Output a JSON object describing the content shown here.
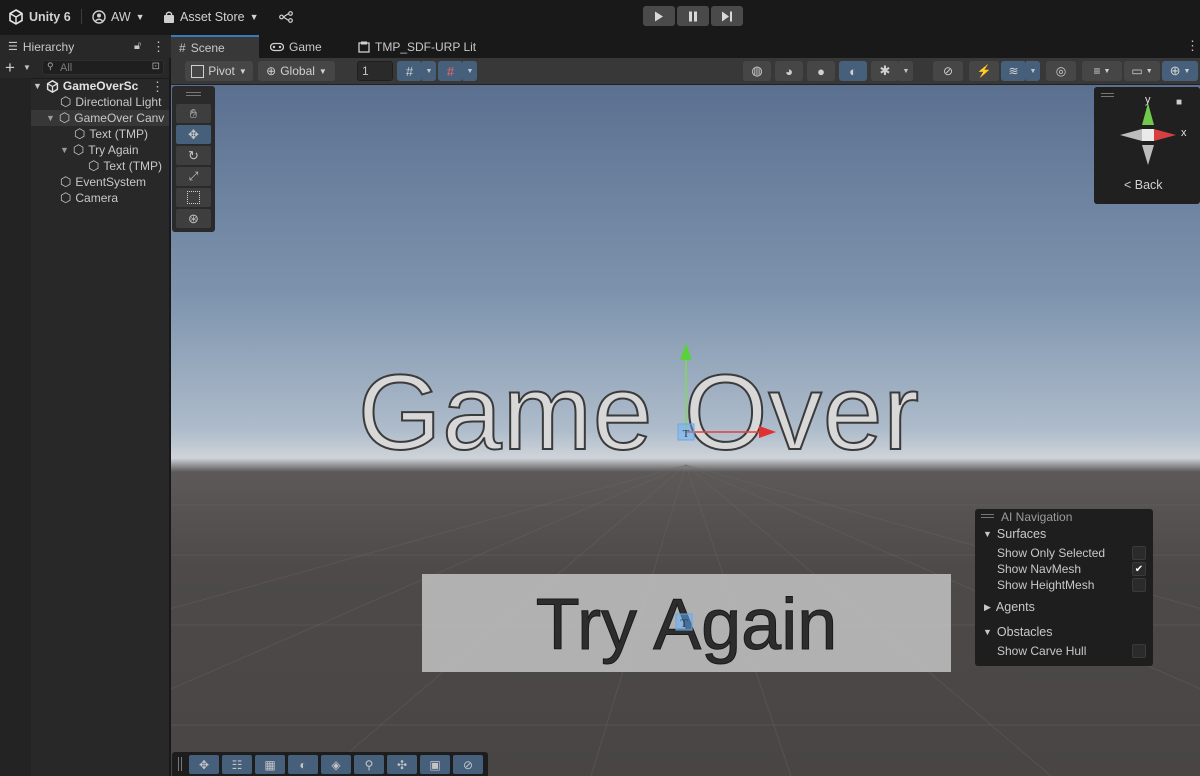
{
  "topbar": {
    "app": "Unity 6",
    "account": "AW",
    "asset_store": "Asset Store"
  },
  "tabs": {
    "hierarchy": "Hierarchy",
    "scene": "Scene",
    "game": "Game",
    "material": "TMP_SDF-URP Lit"
  },
  "hierarchy": {
    "search_placeholder": "All",
    "items": [
      {
        "label": "GameOverSc",
        "depth": 0
      },
      {
        "label": "Directional Light",
        "depth": 1
      },
      {
        "label": "GameOver Canv",
        "depth": 1
      },
      {
        "label": "Text (TMP)",
        "depth": 2
      },
      {
        "label": "Try Again",
        "depth": 2
      },
      {
        "label": "Text (TMP)",
        "depth": 3
      },
      {
        "label": "EventSystem",
        "depth": 1
      },
      {
        "label": "Camera",
        "depth": 1
      }
    ]
  },
  "scene_toolbar": {
    "pivot": "Pivot",
    "global": "Global",
    "grid_size": "1"
  },
  "gizmo": {
    "y_label": "y",
    "x_label": "x",
    "back": "< Back"
  },
  "ai_navigation": {
    "title": "AI Navigation",
    "surfaces": "Surfaces",
    "show_only_selected": "Show Only Selected",
    "show_navmesh": "Show NavMesh",
    "show_heightmesh": "Show HeightMesh",
    "agents": "Agents",
    "obstacles": "Obstacles",
    "show_carve_hull": "Show Carve Hull",
    "show_navmesh_checked": true
  },
  "scene_content": {
    "title_text": "Game Over",
    "button_text": "Try Again"
  },
  "colors": {
    "accent": "#3a79bb",
    "selected_tool": "#46607c"
  }
}
